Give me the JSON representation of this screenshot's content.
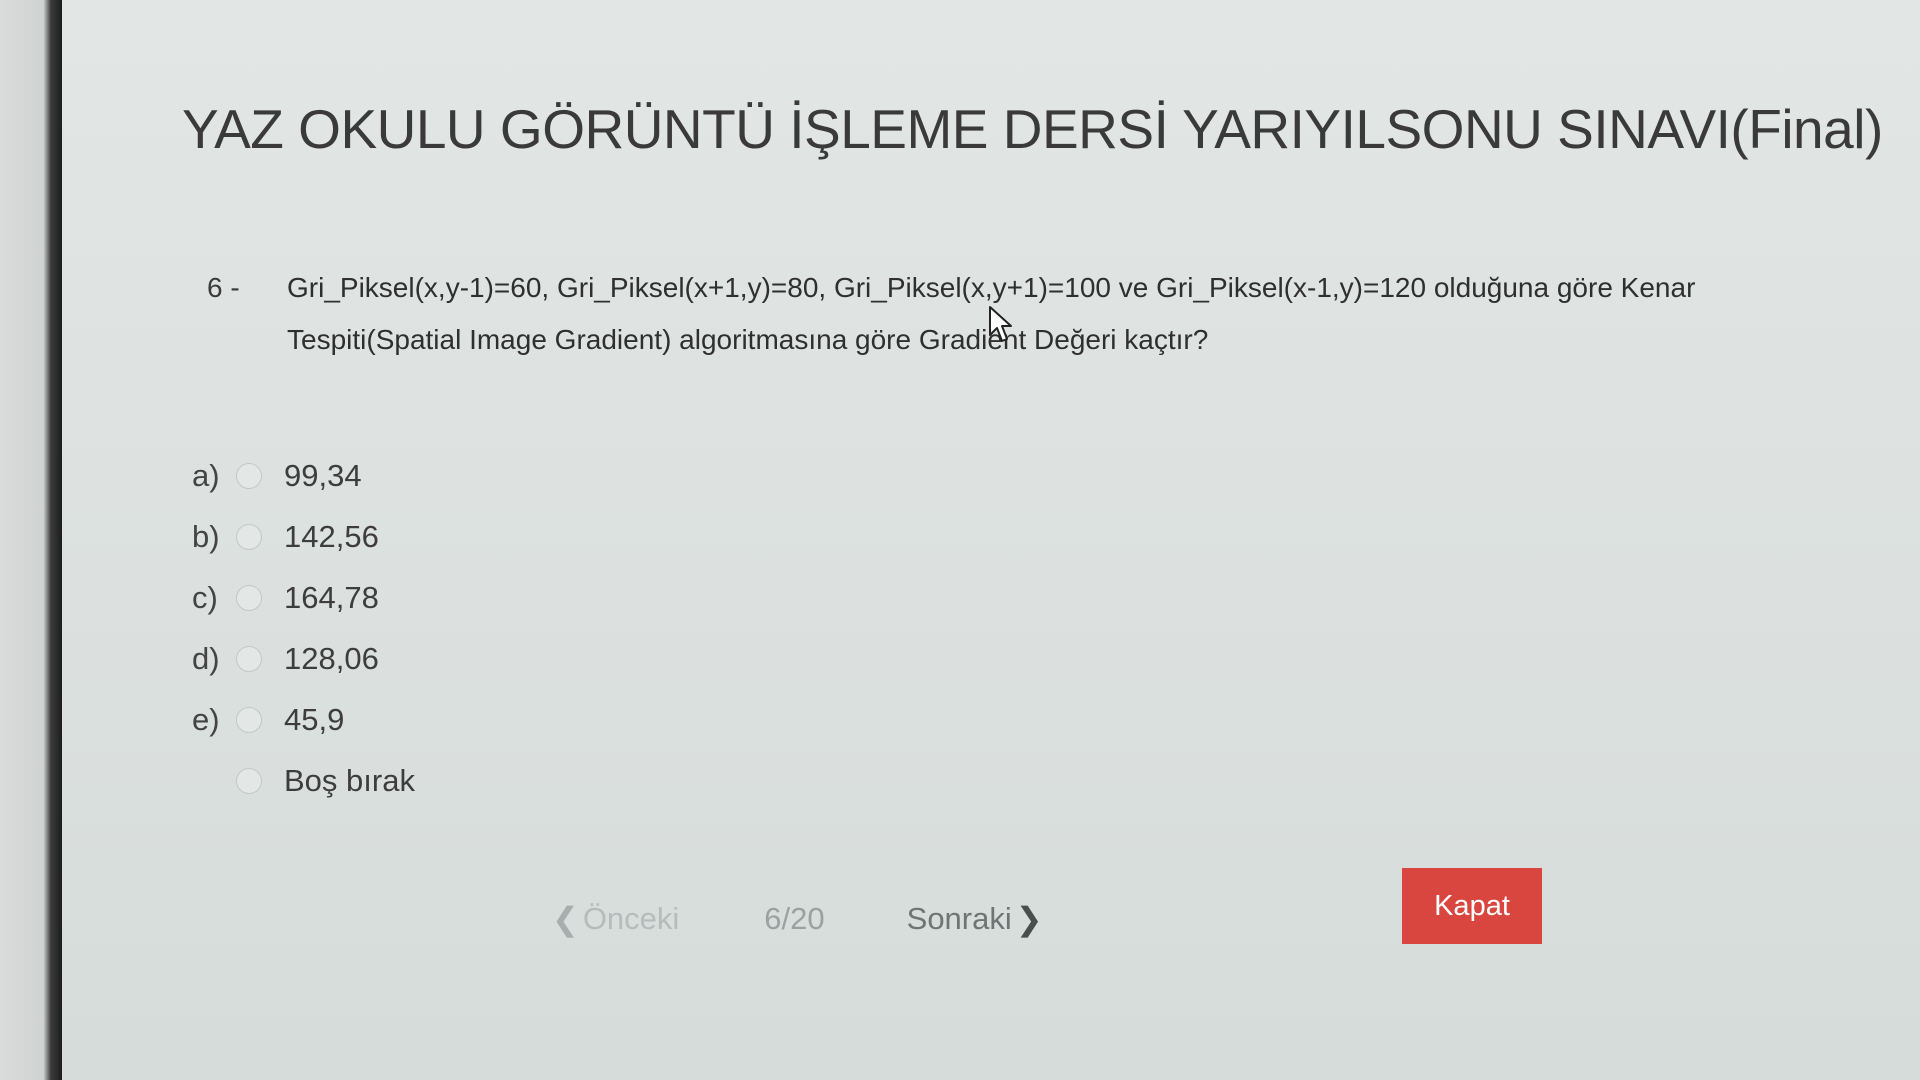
{
  "page": {
    "title": "YAZ OKULU GÖRÜNTÜ İŞLEME DERSİ YARIYILSONU SINAVI(Final)"
  },
  "question": {
    "number": "6 -",
    "text": "Gri_Piksel(x,y-1)=60, Gri_Piksel(x+1,y)=80, Gri_Piksel(x,y+1)=100 ve Gri_Piksel(x-1,y)=120 olduğuna göre Kenar Tespiti(Spatial Image Gradient) algoritmasına göre Gradient Değeri kaçtır?"
  },
  "options": [
    {
      "letter": "a)",
      "value": "99,34"
    },
    {
      "letter": "b)",
      "value": "142,56"
    },
    {
      "letter": "c)",
      "value": "164,78"
    },
    {
      "letter": "d)",
      "value": "128,06"
    },
    {
      "letter": "e)",
      "value": "45,9"
    },
    {
      "letter": "",
      "value": "Boş bırak"
    }
  ],
  "navigation": {
    "prev_label": "Önceki",
    "counter": "6/20",
    "next_label": "Sonraki",
    "prev_icon": "chevron-left-icon",
    "next_icon": "chevron-right-icon"
  },
  "close_button": {
    "label": "Kapat"
  },
  "colors": {
    "close_button_bg": "#d9453f",
    "background": "#dde2e0"
  }
}
